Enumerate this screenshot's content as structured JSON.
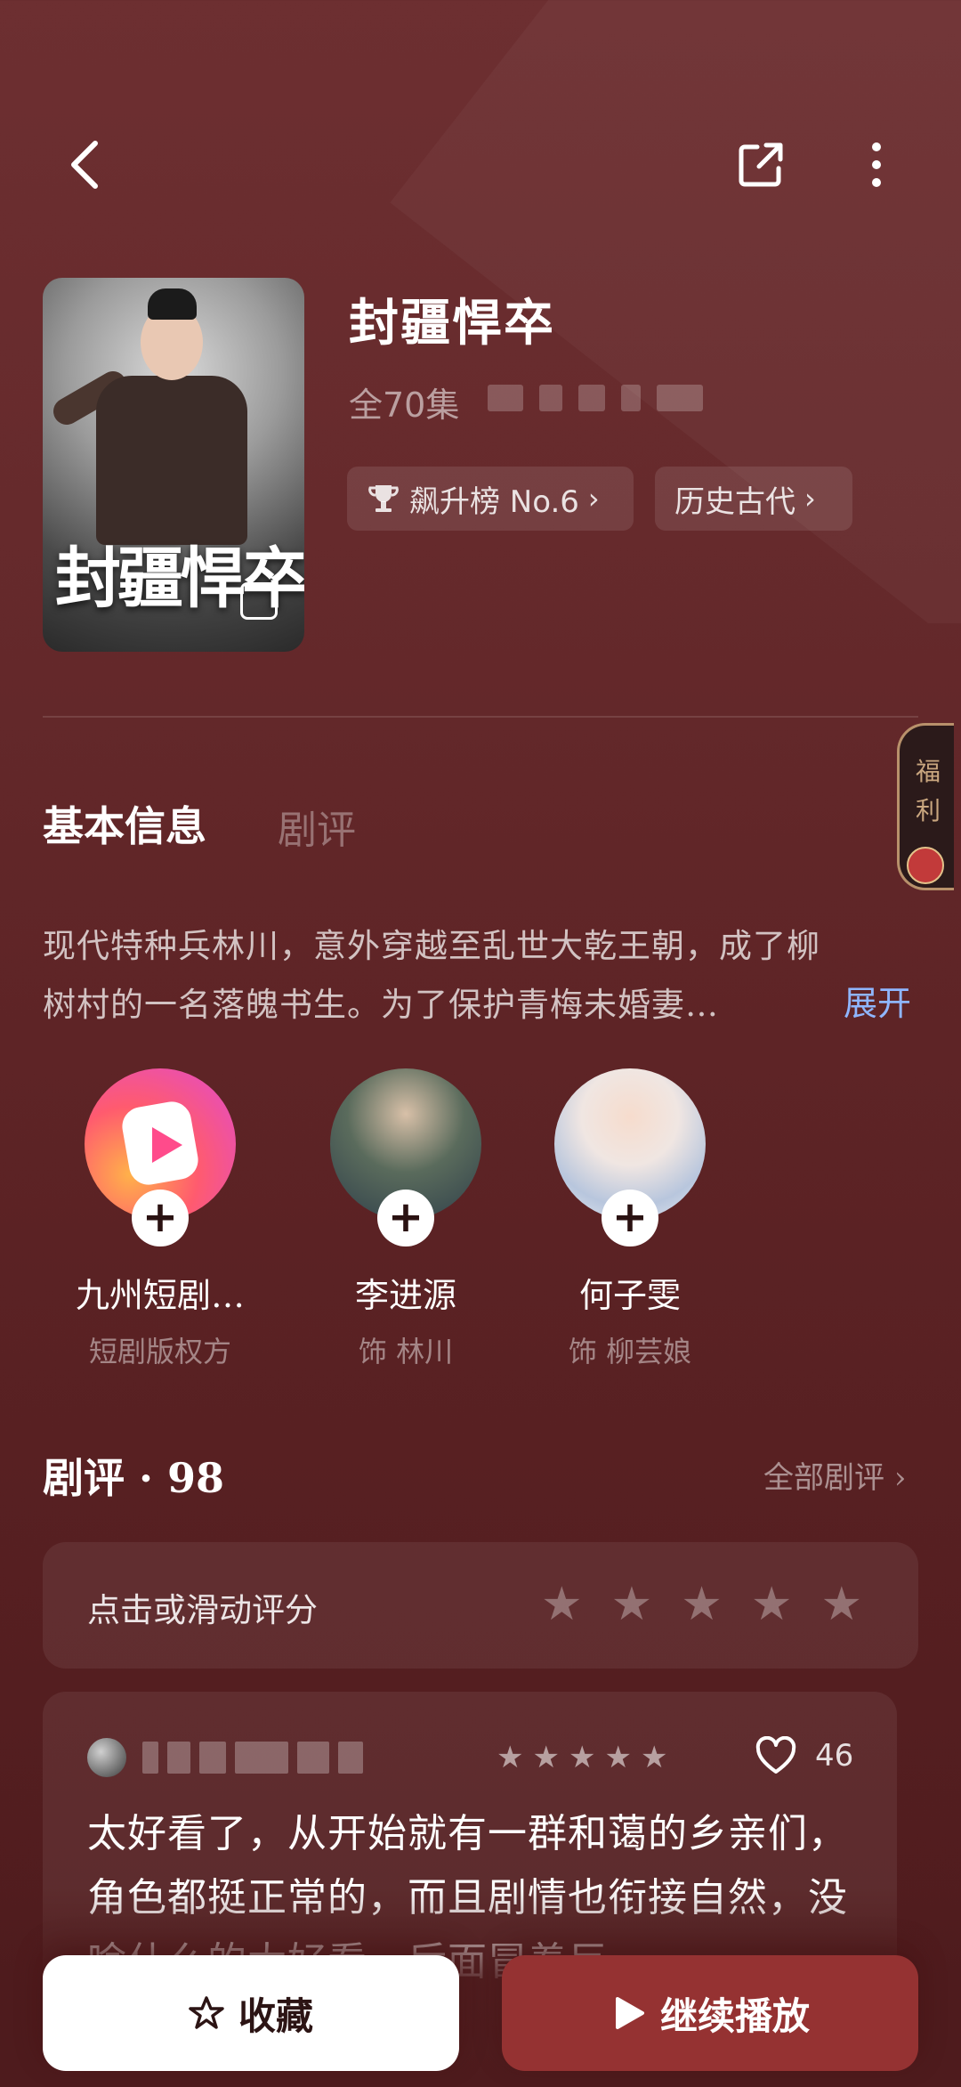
{
  "drama": {
    "title": "封疆悍卒",
    "poster_title": "封疆悍卒",
    "episodes": "全70集",
    "tags": [
      {
        "label": "飙升榜 No.6",
        "icon": "trophy-icon"
      },
      {
        "label": "历史古代"
      }
    ]
  },
  "welfare": {
    "label": "福利"
  },
  "tabs": {
    "info": "基本信息",
    "reviews": "剧评"
  },
  "synopsis": {
    "line1": "现代特种兵林川，意外穿越至乱世大乾王朝，成了柳",
    "line2": "树村的一名落魄书生。为了保护青梅未婚妻…",
    "expand": "展开"
  },
  "cast": [
    {
      "name": "九州短剧…",
      "role": "短剧版权方"
    },
    {
      "name": "李进源",
      "role": "饰 林川"
    },
    {
      "name": "何子雯",
      "role": "饰 柳芸娘"
    }
  ],
  "reviews": {
    "title": "剧评 · 98",
    "all_label": "全部剧评",
    "rate_prompt": "点击或滑动评分",
    "rate_stars": 5,
    "first": {
      "stars": 5,
      "likes": "46",
      "text": "太好看了，从开始就有一群和蔼的乡亲们，角色都挺正常的，而且剧情也衔接自然，没啥什么的太好看，后面冒着巨"
    }
  },
  "actions": {
    "favorite": "收藏",
    "play": "继续播放"
  },
  "colors": {
    "accent": "#953232",
    "link": "#8fb6ff",
    "background": "#5e2426"
  }
}
